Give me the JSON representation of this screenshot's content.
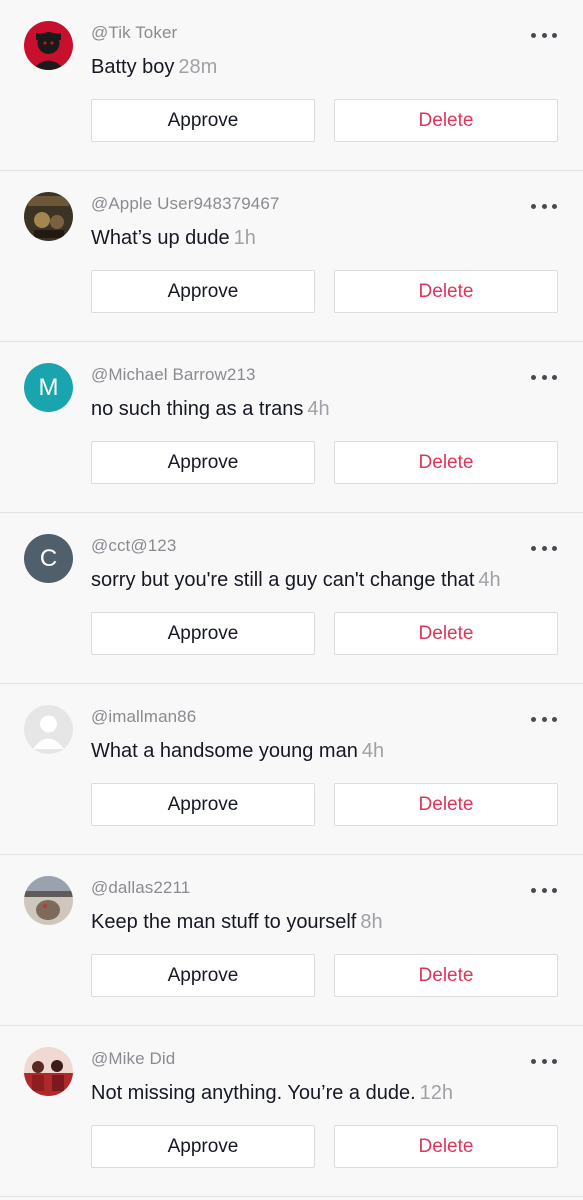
{
  "comments": [
    {
      "username": "@Tik Toker",
      "text": "Batty boy",
      "time": "28m",
      "avatar": {
        "kind": "photo",
        "colors": [
          "#c8102e",
          "#1a1a1a"
        ]
      },
      "approve_label": "Approve",
      "delete_label": "Delete"
    },
    {
      "username": "@Apple User948379467",
      "text": "What’s up dude",
      "time": "1h",
      "avatar": {
        "kind": "photo",
        "colors": [
          "#3b3324",
          "#a4874f"
        ]
      },
      "approve_label": "Approve",
      "delete_label": "Delete"
    },
    {
      "username": "@Michael Barrow213",
      "text": "no such thing as a trans",
      "time": "4h",
      "avatar": {
        "kind": "letter",
        "letter": "M",
        "color": "#1aa5ae"
      },
      "approve_label": "Approve",
      "delete_label": "Delete"
    },
    {
      "username": "@cct@123",
      "text": "sorry but you're still a guy can't change that",
      "time": "4h",
      "avatar": {
        "kind": "letter",
        "letter": "C",
        "color": "#4f5f6b"
      },
      "approve_label": "Approve",
      "delete_label": "Delete"
    },
    {
      "username": "@imallman86",
      "text": "What a handsome young man",
      "time": "4h",
      "avatar": {
        "kind": "default",
        "colors": [
          "#e6e6e6",
          "#ffffff"
        ]
      },
      "approve_label": "Approve",
      "delete_label": "Delete"
    },
    {
      "username": "@dallas2211",
      "text": "Keep the man stuff to yourself",
      "time": "8h",
      "avatar": {
        "kind": "photo",
        "colors": [
          "#7d6a5a",
          "#cfc7bd"
        ]
      },
      "approve_label": "Approve",
      "delete_label": "Delete"
    },
    {
      "username": "@Mike Did",
      "text": "Not missing anything. You’re a dude.",
      "time": "12h",
      "avatar": {
        "kind": "photo",
        "colors": [
          "#b0282a",
          "#f0d9d2"
        ]
      },
      "approve_label": "Approve",
      "delete_label": "Delete"
    }
  ],
  "icons": {
    "more": "more-options-icon"
  },
  "theme": {
    "accent": "#e1345a",
    "muted": "#8a8b91",
    "background": "#f8f8f8"
  }
}
